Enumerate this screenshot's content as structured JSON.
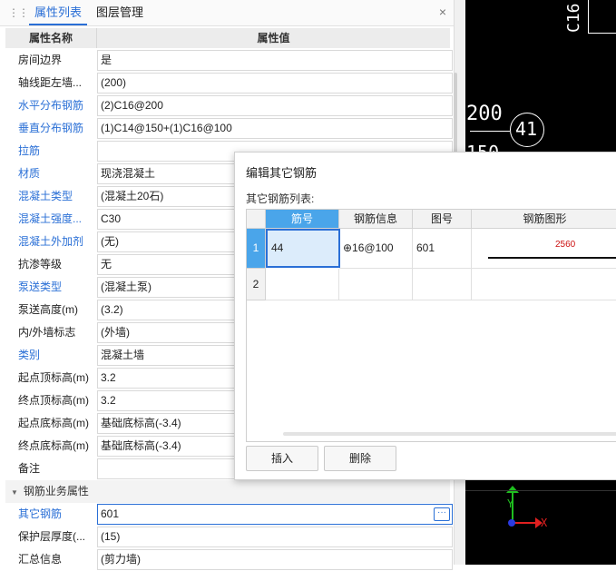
{
  "panel": {
    "tabs": [
      {
        "label": "属性列表"
      },
      {
        "label": "图层管理"
      }
    ],
    "close_glyph": "×",
    "header": {
      "name": "属性名称",
      "value": "属性值"
    },
    "rows": [
      {
        "name": "房间边界",
        "value": "是",
        "link": false
      },
      {
        "name": "轴线距左墙...",
        "value": "(200)",
        "link": false
      },
      {
        "name": "水平分布钢筋",
        "value": "(2)C16@200",
        "link": true
      },
      {
        "name": "垂直分布钢筋",
        "value": "(1)C14@150+(1)C16@100",
        "link": true
      },
      {
        "name": "拉筋",
        "value": "",
        "link": true
      },
      {
        "name": "材质",
        "value": "现浇混凝土",
        "link": true
      },
      {
        "name": "混凝土类型",
        "value": "(混凝土20石)",
        "link": true
      },
      {
        "name": "混凝土强度...",
        "value": "C30",
        "link": true
      },
      {
        "name": "混凝土外加剂",
        "value": "(无)",
        "link": true
      },
      {
        "name": "抗渗等级",
        "value": "无",
        "link": false
      },
      {
        "name": "泵送类型",
        "value": "(混凝土泵)",
        "link": true
      },
      {
        "name": "泵送高度(m)",
        "value": "(3.2)",
        "link": false
      },
      {
        "name": "内/外墙标志",
        "value": "(外墙)",
        "link": false
      },
      {
        "name": "类别",
        "value": "混凝土墙",
        "link": true
      },
      {
        "name": "起点顶标高(m)",
        "value": "3.2",
        "link": false
      },
      {
        "name": "终点顶标高(m)",
        "value": "3.2",
        "link": false
      },
      {
        "name": "起点底标高(m)",
        "value": "基础底标高(-3.4)",
        "link": false
      },
      {
        "name": "终点底标高(m)",
        "value": "基础底标高(-3.4)",
        "link": false
      },
      {
        "name": "备注",
        "value": "",
        "link": false
      }
    ],
    "group_label": "钢筋业务属性",
    "group_rows": [
      {
        "name": "其它钢筋",
        "value": "601",
        "link": true
      },
      {
        "name": "保护层厚度(...",
        "value": "(15)",
        "link": false
      },
      {
        "name": "汇总信息",
        "value": "(剪力墙)",
        "link": false
      }
    ],
    "ellipsis": "···"
  },
  "dialog": {
    "title": "编辑其它钢筋",
    "list_label": "其它钢筋列表:",
    "columns": [
      "筋号",
      "钢筋信息",
      "图号",
      "钢筋图形"
    ],
    "rows": [
      {
        "index": "1",
        "bar_no": "44",
        "info": "⊕16@100",
        "fig_no": "601",
        "shape_value": "2560"
      },
      {
        "index": "2",
        "bar_no": "",
        "info": "",
        "fig_no": "",
        "shape_value": ""
      }
    ],
    "insert_label": "插入",
    "delete_label": "删除"
  },
  "cad": {
    "labels": [
      "C16",
      "200",
      "41",
      "150"
    ],
    "axis_x": "X",
    "axis_y": "Y"
  },
  "colors": {
    "accent": "#2a6fd6",
    "header_active": "#4aa5ea",
    "dimension_red": "#cc1111"
  }
}
